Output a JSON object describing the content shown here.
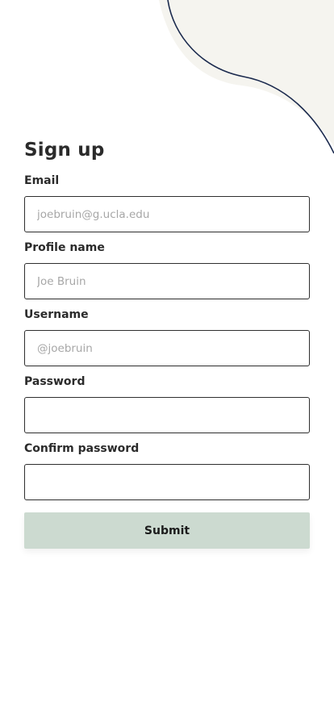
{
  "colors": {
    "blob_fill": "#f5f4ef",
    "curve_stroke": "#1b2a4e",
    "button_bg": "#ccdad0",
    "input_border": "#2e2e2e",
    "placeholder": "#a7a7a7"
  },
  "form": {
    "title": "Sign up",
    "fields": [
      {
        "label": "Email",
        "placeholder": "joebruin@g.ucla.edu",
        "value": ""
      },
      {
        "label": "Profile name",
        "placeholder": "Joe Bruin",
        "value": ""
      },
      {
        "label": "Username",
        "placeholder": "@joebruin",
        "value": ""
      },
      {
        "label": "Password",
        "placeholder": "",
        "value": ""
      },
      {
        "label": "Confirm password",
        "placeholder": "",
        "value": ""
      }
    ],
    "submit_label": "Submit"
  }
}
